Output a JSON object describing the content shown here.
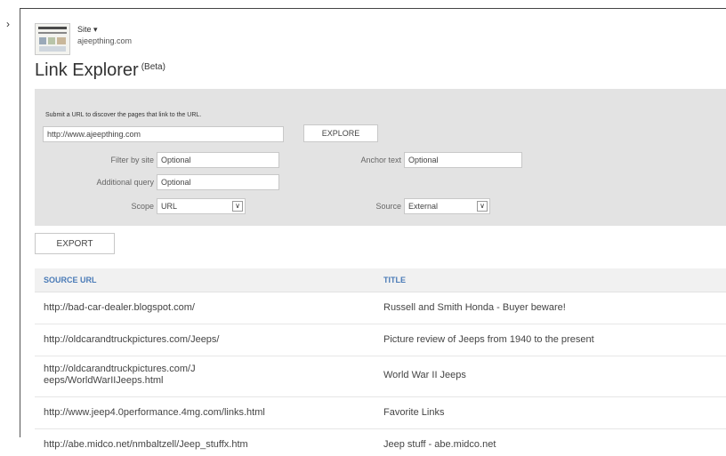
{
  "site": {
    "switcher_label": "Site",
    "dropdown_arrow": "▾",
    "domain": "ajeepthing.com"
  },
  "page": {
    "title": "Link Explorer",
    "badge": "(Beta)"
  },
  "form": {
    "instructions": "Submit a URL to discover the pages that link to the URL.",
    "url_value": "http://www.ajeepthing.com",
    "explore_label": "EXPLORE",
    "filter_site_label": "Filter by site",
    "filter_site_value": "Optional",
    "anchor_text_label": "Anchor text",
    "anchor_text_value": "Optional",
    "additional_query_label": "Additional query",
    "additional_query_value": "Optional",
    "scope_label": "Scope",
    "scope_value": "URL",
    "source_label": "Source",
    "source_value": "External"
  },
  "export_label": "EXPORT",
  "table": {
    "col_source_url": "SOURCE URL",
    "col_title": "TITLE",
    "rows": [
      {
        "url": "http://bad-car-dealer.blogspot.com/",
        "title": "Russell and Smith Honda - Buyer beware!"
      },
      {
        "url": "http://oldcarandtruckpictures.com/Jeeps/",
        "title": "Picture review of Jeeps from 1940 to the present"
      },
      {
        "url": "http://oldcarandtruckpictures.com/J eeps/WorldWarIIJeeps.html",
        "title": "World War II Jeeps"
      },
      {
        "url": "http://www.jeep4.0performance.4mg.com/links.html",
        "title": "Favorite Links"
      },
      {
        "url": "http://abe.midco.net/nmbaltzell/Jeep_stuffx.htm",
        "title": "Jeep stuff - abe.midco.net"
      }
    ]
  },
  "colors": {
    "panel_bg": "#e3e3e3",
    "header_link": "#4a7bb7",
    "text": "#444444"
  },
  "icons": {
    "sidebar_toggle": "chevron-right-icon",
    "select_toggle": "chevron-down-icon"
  }
}
